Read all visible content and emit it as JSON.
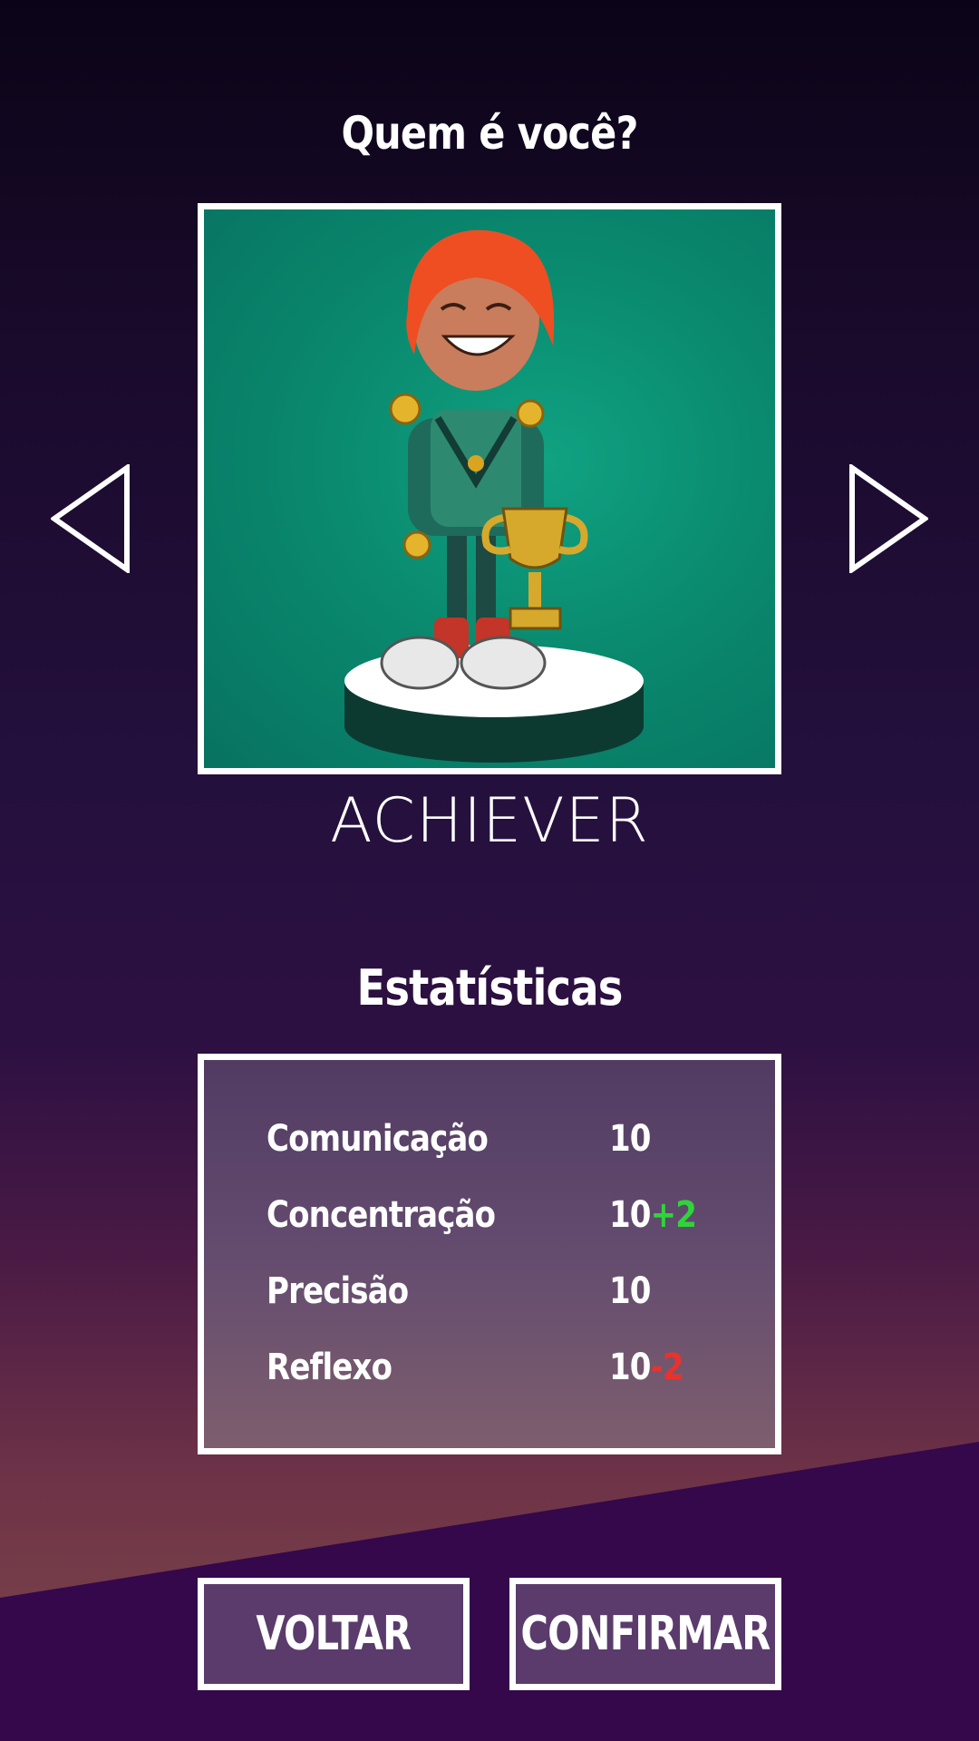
{
  "header": {
    "title": "Quem é você?"
  },
  "character": {
    "class_name": "ACHIEVER",
    "image_icon": "achiever-character-illustration"
  },
  "navigation": {
    "prev_icon": "triangle-left-icon",
    "next_icon": "triangle-right-icon"
  },
  "stats": {
    "title": "Estatísticas",
    "rows": [
      {
        "label": "Comunicação",
        "value": "10",
        "bonus": ""
      },
      {
        "label": "Concentração",
        "value": "10",
        "bonus": "+2"
      },
      {
        "label": "Precisão",
        "value": "10",
        "bonus": ""
      },
      {
        "label": "Reflexo",
        "value": "10",
        "bonus": "-2"
      }
    ]
  },
  "buttons": {
    "back_label": "VOLTAR",
    "confirm_label": "CONFIRMAR"
  },
  "colors": {
    "positive_bonus": "#2fd43a",
    "negative_bonus": "#e8332c",
    "portrait_bg": "#0a8a6f",
    "button_bg": "#5a3b6b",
    "lower_band": "#34084b"
  }
}
